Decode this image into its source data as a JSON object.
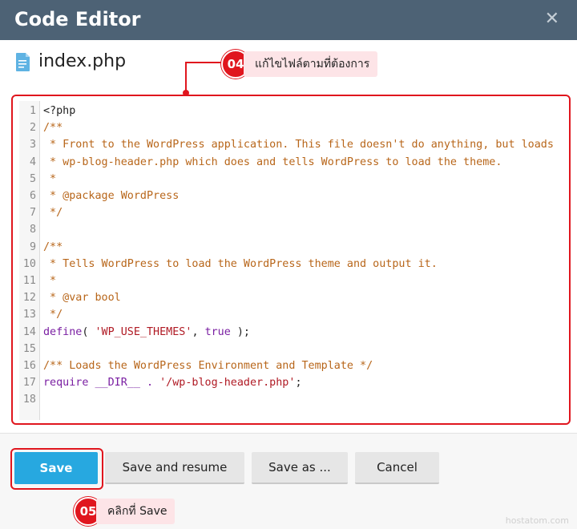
{
  "dialog": {
    "title": "Code Editor",
    "close_icon": "close-icon"
  },
  "file": {
    "icon": "file-document-icon",
    "name": "index.php"
  },
  "annotations": {
    "step4": {
      "number": "04",
      "label": "แก้ไขไฟล์ตามที่ต้องการ"
    },
    "step5": {
      "number": "05",
      "label": "คลิกที่ Save"
    }
  },
  "editor": {
    "lines": [
      {
        "n": "1",
        "segments": [
          {
            "t": "<?php",
            "c": "default"
          }
        ]
      },
      {
        "n": "2",
        "segments": [
          {
            "t": "/**",
            "c": "comment"
          }
        ]
      },
      {
        "n": "3",
        "segments": [
          {
            "t": " * Front to the WordPress application. This file doesn't do anything, but loads",
            "c": "comment"
          }
        ]
      },
      {
        "n": "4",
        "segments": [
          {
            "t": " * wp-blog-header.php which does and tells WordPress to load the theme.",
            "c": "comment"
          }
        ]
      },
      {
        "n": "5",
        "segments": [
          {
            "t": " *",
            "c": "comment"
          }
        ]
      },
      {
        "n": "6",
        "segments": [
          {
            "t": " * @package WordPress",
            "c": "comment"
          }
        ]
      },
      {
        "n": "7",
        "segments": [
          {
            "t": " */",
            "c": "comment"
          }
        ]
      },
      {
        "n": "8",
        "segments": []
      },
      {
        "n": "9",
        "segments": [
          {
            "t": "/**",
            "c": "comment"
          }
        ]
      },
      {
        "n": "10",
        "segments": [
          {
            "t": " * Tells WordPress to load the WordPress theme and output it.",
            "c": "comment"
          }
        ]
      },
      {
        "n": "11",
        "segments": [
          {
            "t": " *",
            "c": "comment"
          }
        ]
      },
      {
        "n": "12",
        "segments": [
          {
            "t": " * @var bool",
            "c": "comment"
          }
        ]
      },
      {
        "n": "13",
        "segments": [
          {
            "t": " */",
            "c": "comment"
          }
        ]
      },
      {
        "n": "14",
        "segments": [
          {
            "t": "define",
            "c": "keyword"
          },
          {
            "t": "( ",
            "c": "paren"
          },
          {
            "t": "'WP_USE_THEMES'",
            "c": "string"
          },
          {
            "t": ", ",
            "c": "paren"
          },
          {
            "t": "true",
            "c": "keyword"
          },
          {
            "t": " );",
            "c": "paren"
          }
        ]
      },
      {
        "n": "15",
        "segments": []
      },
      {
        "n": "16",
        "segments": [
          {
            "t": "/** Loads the WordPress Environment and Template */",
            "c": "comment"
          }
        ]
      },
      {
        "n": "17",
        "segments": [
          {
            "t": "require",
            "c": "keyword"
          },
          {
            "t": " __DIR__ . ",
            "c": "keyword"
          },
          {
            "t": "'/wp-blog-header.php'",
            "c": "string"
          },
          {
            "t": ";",
            "c": "paren"
          }
        ]
      },
      {
        "n": "18",
        "segments": []
      }
    ]
  },
  "buttons": {
    "save": "Save",
    "save_resume": "Save and resume",
    "save_as": "Save as ...",
    "cancel": "Cancel"
  },
  "watermark": "hostatom.com",
  "colors": {
    "header_bg": "#4d6275",
    "accent_blue": "#27a8e0",
    "highlight_red": "#e0161e",
    "comment_orange": "#b8661a",
    "keyword_purple": "#7a1fa2",
    "string_red": "#b01a24"
  }
}
